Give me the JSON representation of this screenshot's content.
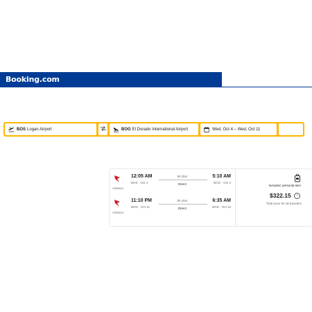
{
  "header": {
    "brand": "Booking.com"
  },
  "search": {
    "from_code": "BOS",
    "from_name": "Logan Airport",
    "to_code": "BOG",
    "to_name": "El Dorado International Airport",
    "dates": "Wed, Oct 4 – Wed, Oct 11"
  },
  "result": {
    "legs": [
      {
        "airline": "Avianca",
        "dep_time": "12:05 AM",
        "dep_place": "BOS · Oct 4",
        "duration": "6h 05m",
        "stops": "Direct",
        "arr_time": "5:10 AM",
        "arr_place": "BOG · Oct 4"
      },
      {
        "airline": "Avianca",
        "dep_time": "11:10 PM",
        "dep_place": "BOG · Oct 11",
        "duration": "6h 25m",
        "stops": "Direct",
        "arr_time": "6:35 AM",
        "arr_place": "BOS · Oct 12"
      }
    ],
    "included": "Included: personal item",
    "price": "$322.15",
    "price_note": "Total price for all travelers"
  },
  "colors": {
    "brand": "#003b95",
    "accent": "#ffb700",
    "airline": "#d71920"
  }
}
